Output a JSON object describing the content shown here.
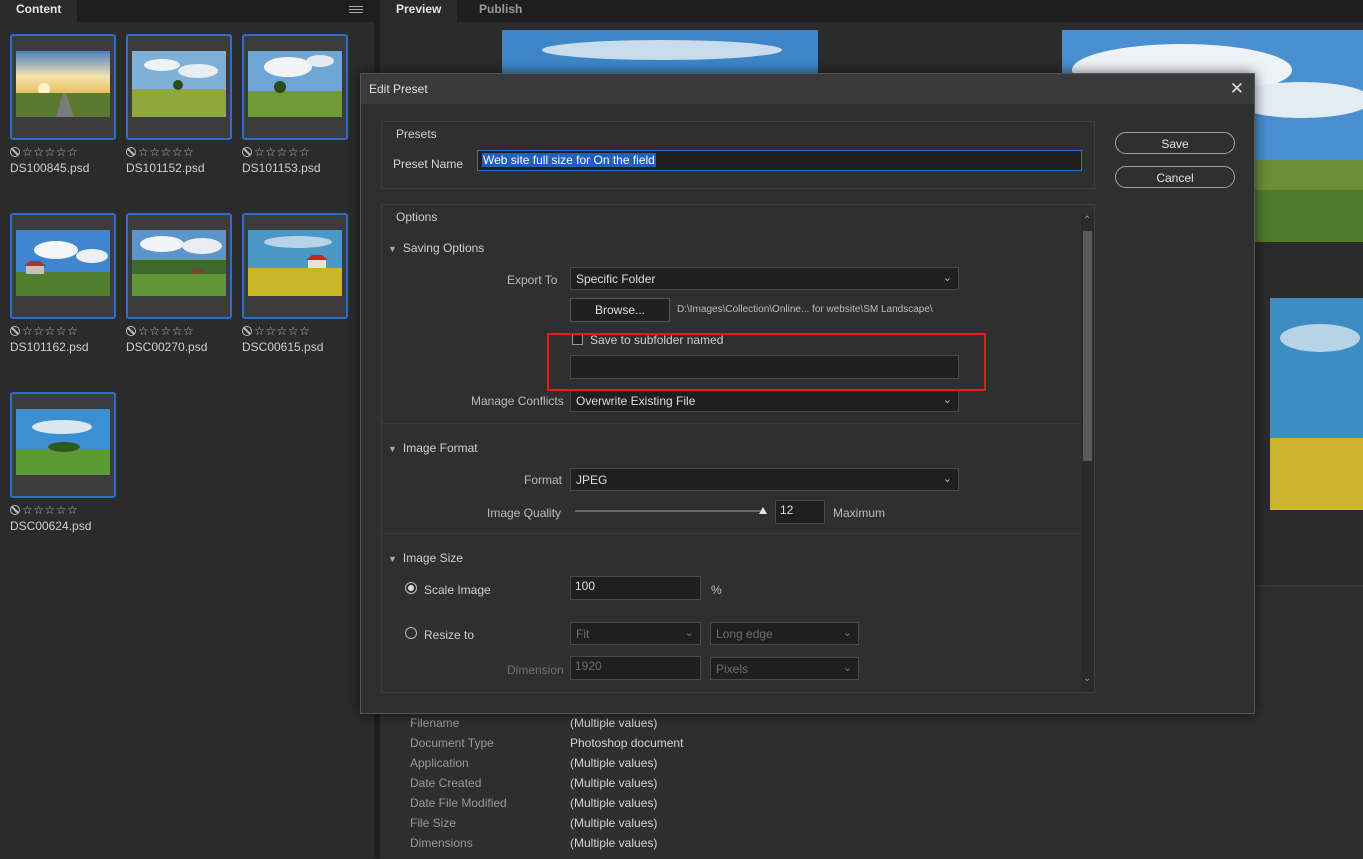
{
  "left_tabs": {
    "content": "Content"
  },
  "right_tabs": {
    "preview": "Preview",
    "publish": "Publish"
  },
  "thumbnails": [
    {
      "name": "DS100845.psd",
      "rating": "☆☆☆☆☆"
    },
    {
      "name": "DS101152.psd",
      "rating": "☆☆☆☆☆"
    },
    {
      "name": "DS101153.psd",
      "rating": "☆☆☆☆☆"
    },
    {
      "name": "DS101162.psd",
      "rating": "☆☆☆☆☆"
    },
    {
      "name": "DSC00270.psd",
      "rating": "☆☆☆☆☆"
    },
    {
      "name": "DSC00615.psd",
      "rating": "☆☆☆☆☆"
    },
    {
      "name": "DSC00624.psd",
      "rating": "☆☆☆☆☆"
    }
  ],
  "metadata": [
    {
      "key": "Filename",
      "value": "(Multiple values)"
    },
    {
      "key": "Document Type",
      "value": "Photoshop document"
    },
    {
      "key": "Application",
      "value": "(Multiple values)"
    },
    {
      "key": "Date Created",
      "value": "(Multiple values)"
    },
    {
      "key": "Date File Modified",
      "value": "(Multiple values)"
    },
    {
      "key": "File Size",
      "value": "(Multiple values)"
    },
    {
      "key": "Dimensions",
      "value": "(Multiple values)"
    }
  ],
  "dialog": {
    "title": "Edit Preset",
    "close": "✕",
    "presets_heading": "Presets",
    "preset_name_label": "Preset Name",
    "preset_name_value": "Web site full size for On the field",
    "save": "Save",
    "cancel": "Cancel",
    "options_heading": "Options",
    "saving_options": {
      "heading": "Saving Options",
      "export_to_label": "Export To",
      "export_to_value": "Specific Folder",
      "browse": "Browse...",
      "path": "D:\\Images\\Collection\\Online... for website\\SM Landscape\\",
      "subfolder_label": "Save to subfolder named",
      "subfolder_value": "",
      "manage_conflicts_label": "Manage Conflicts",
      "manage_conflicts_value": "Overwrite Existing File"
    },
    "image_format": {
      "heading": "Image Format",
      "format_label": "Format",
      "format_value": "JPEG",
      "quality_label": "Image Quality",
      "quality_value": "12",
      "quality_fraction": 1.0,
      "quality_text": "Maximum"
    },
    "image_size": {
      "heading": "Image Size",
      "scale_label": "Scale Image",
      "scale_value": "100",
      "scale_unit": "%",
      "resize_label": "Resize to",
      "fit_value": "Fit",
      "edge_value": "Long edge",
      "dimension_label": "Dimension",
      "dimension_value": "1920",
      "unit_value": "Pixels"
    }
  },
  "colors": {
    "selection_border": "#2f6fc8",
    "highlight_red": "#e01c1c",
    "text_selection": "#1f5fbf"
  }
}
